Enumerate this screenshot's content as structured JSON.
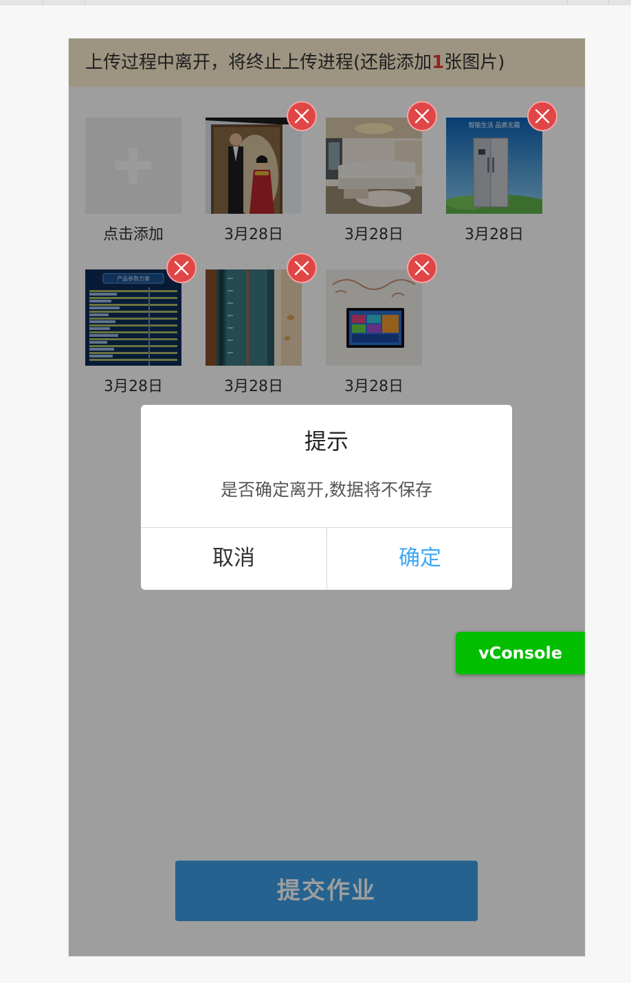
{
  "banner": {
    "prefix": "上传过程中离开，将终止上传进程(还能添加",
    "count": "1",
    "suffix": "张图片)"
  },
  "add_tile": {
    "label": "点击添加"
  },
  "photos": [
    {
      "caption": "3月28日",
      "subject": "wedding-couple-photo"
    },
    {
      "caption": "3月28日",
      "subject": "living-room-sofa-photo"
    },
    {
      "caption": "3月28日",
      "subject": "refrigerator-ad-photo",
      "ad_text": "智能生活 品质无霜"
    },
    {
      "caption": "3月28日",
      "subject": "product-parameter-table-photo",
      "heading": "产品参数方案"
    },
    {
      "caption": "3月28日",
      "subject": "door-frame-closeup-photo"
    },
    {
      "caption": "3月28日",
      "subject": "wall-mounted-tv-photo"
    }
  ],
  "dialog": {
    "title": "提示",
    "message": "是否确定离开,数据将不保存",
    "cancel_label": "取消",
    "confirm_label": "确定"
  },
  "submit_label": "提交作业",
  "vconsole_label": "vConsole",
  "colors": {
    "banner_bg": "#fdf1d0",
    "delete_badge": "#e04646",
    "submit_button": "#3d9ee7",
    "confirm_text": "#3ea8f5",
    "vconsole": "#04be02",
    "count_highlight": "#e53935"
  }
}
